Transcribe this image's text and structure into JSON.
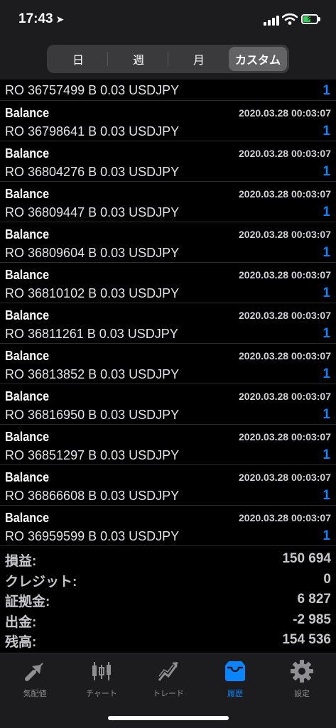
{
  "status_bar": {
    "time": "17:43"
  },
  "segments": [
    {
      "label": "日"
    },
    {
      "label": "週"
    },
    {
      "label": "月"
    },
    {
      "label": "カスタム"
    }
  ],
  "rows": [
    {
      "title": "",
      "date": "",
      "desc": "RO 36757499 B 0.03 USDJPY",
      "value": "1"
    },
    {
      "title": "Balance",
      "date": "2020.03.28 00:03:07",
      "desc": "RO 36798641 B 0.03 USDJPY",
      "value": "1"
    },
    {
      "title": "Balance",
      "date": "2020.03.28 00:03:07",
      "desc": "RO 36804276 B 0.03 USDJPY",
      "value": "1"
    },
    {
      "title": "Balance",
      "date": "2020.03.28 00:03:07",
      "desc": "RO 36809447 B 0.03 USDJPY",
      "value": "1"
    },
    {
      "title": "Balance",
      "date": "2020.03.28 00:03:07",
      "desc": "RO 36809604 B 0.03 USDJPY",
      "value": "1"
    },
    {
      "title": "Balance",
      "date": "2020.03.28 00:03:07",
      "desc": "RO 36810102 B 0.03 USDJPY",
      "value": "1"
    },
    {
      "title": "Balance",
      "date": "2020.03.28 00:03:07",
      "desc": "RO 36811261 B 0.03 USDJPY",
      "value": "1"
    },
    {
      "title": "Balance",
      "date": "2020.03.28 00:03:07",
      "desc": "RO 36813852 B 0.03 USDJPY",
      "value": "1"
    },
    {
      "title": "Balance",
      "date": "2020.03.28 00:03:07",
      "desc": "RO 36816950 B 0.03 USDJPY",
      "value": "1"
    },
    {
      "title": "Balance",
      "date": "2020.03.28 00:03:07",
      "desc": "RO 36851297 B 0.03 USDJPY",
      "value": "1"
    },
    {
      "title": "Balance",
      "date": "2020.03.28 00:03:07",
      "desc": "RO 36866608 B 0.03 USDJPY",
      "value": "1"
    },
    {
      "title": "Balance",
      "date": "2020.03.28 00:03:07",
      "desc": "RO 36959599 B 0.03 USDJPY",
      "value": "1"
    }
  ],
  "summary": [
    {
      "label": "損益:",
      "value": "150 694"
    },
    {
      "label": "クレジット:",
      "value": "0"
    },
    {
      "label": "証拠金:",
      "value": "6 827"
    },
    {
      "label": "出金:",
      "value": "-2 985"
    },
    {
      "label": "残高:",
      "value": "154 536"
    }
  ],
  "tabs": [
    {
      "label": "気配値",
      "icon": "quotes-icon"
    },
    {
      "label": "チャート",
      "icon": "chart-icon"
    },
    {
      "label": "トレード",
      "icon": "trade-icon"
    },
    {
      "label": "履歴",
      "icon": "history-icon"
    },
    {
      "label": "設定",
      "icon": "settings-icon"
    }
  ],
  "colors": {
    "accent": "#0a84ff",
    "background": "#000000",
    "bar": "#1c1c1e"
  }
}
